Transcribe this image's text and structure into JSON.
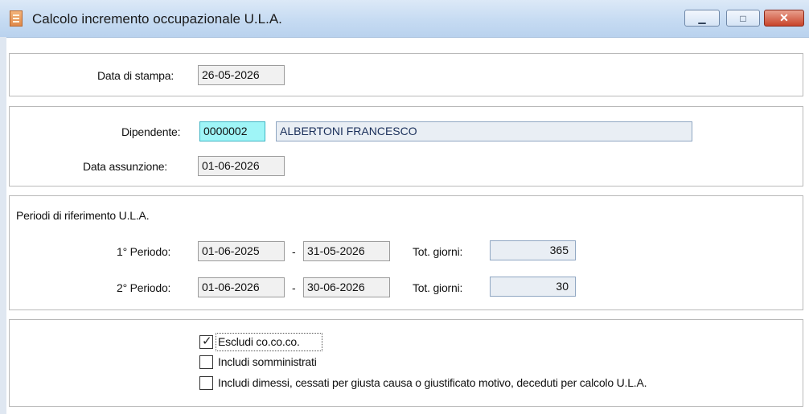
{
  "window": {
    "title": "Calcolo incremento occupazionale U.L.A.",
    "min_glyph": "▁",
    "max_glyph": "□",
    "close_glyph": "✕"
  },
  "header": {
    "label": "Data di stampa:",
    "value": "26-05-2026"
  },
  "employee": {
    "dipendente_label": "Dipendente:",
    "code": "0000002",
    "name": "ALBERTONI FRANCESCO",
    "data_assunzione_label": "Data assunzione:",
    "data_assunzione": "01-06-2026"
  },
  "periods": {
    "section_title": "Periodi di riferimento U.L.A.",
    "rows": [
      {
        "label": "1° Periodo:",
        "from": "01-06-2025",
        "sep": "-",
        "to": "31-05-2026",
        "tot_label": "Tot. giorni:",
        "tot": "365"
      },
      {
        "label": "2° Periodo:",
        "from": "01-06-2026",
        "sep": "-",
        "to": "30-06-2026",
        "tot_label": "Tot. giorni:",
        "tot": "30"
      }
    ]
  },
  "options": [
    {
      "label": "Escludi co.co.co.",
      "checked": true
    },
    {
      "label": "Includi somministrati",
      "checked": false
    },
    {
      "label": "Includi dimessi, cessati per giusta causa o giustificato motivo, deceduti per calcolo U.L.A.",
      "checked": false
    }
  ],
  "check_glyph": "✓"
}
